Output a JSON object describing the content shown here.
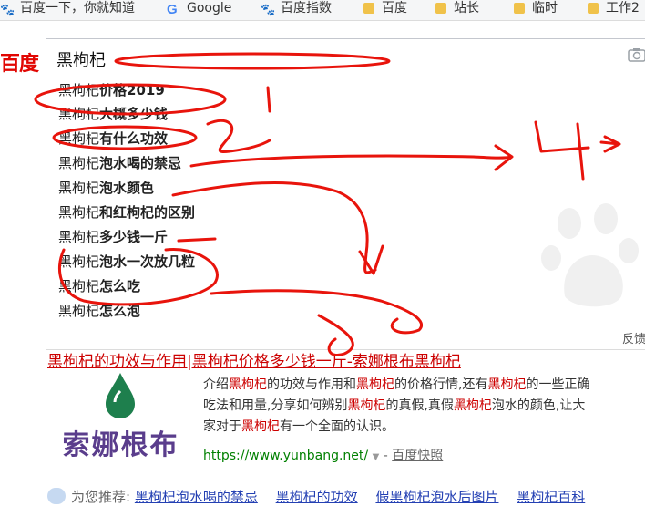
{
  "bookmarks": [
    {
      "label": "百度一下，你就知道",
      "icon": "baidu-paw-icon"
    },
    {
      "label": "Google",
      "icon": "google-icon"
    },
    {
      "label": "百度指数",
      "icon": "baidu-paw-icon"
    },
    {
      "label": "百度",
      "icon": "folder-icon"
    },
    {
      "label": "站长",
      "icon": "folder-icon"
    },
    {
      "label": "临时",
      "icon": "folder-icon"
    },
    {
      "label": "工作2",
      "icon": "folder-icon"
    }
  ],
  "logo": {
    "text": "百度"
  },
  "search": {
    "value": "黑枸杞"
  },
  "suggestions": [
    {
      "prefix": "黑枸杞",
      "suffix": "价格2019"
    },
    {
      "prefix": "黑枸杞",
      "suffix": "大概多少钱"
    },
    {
      "prefix": "黑枸杞",
      "suffix": "有什么功效"
    },
    {
      "prefix": "黑枸杞",
      "suffix": "泡水喝的禁忌"
    },
    {
      "prefix": "黑枸杞",
      "suffix": "泡水颜色"
    },
    {
      "prefix": "黑枸杞",
      "suffix": "和红枸杞的区别"
    },
    {
      "prefix": "黑枸杞",
      "suffix": "多少钱一斤"
    },
    {
      "prefix": "黑枸杞",
      "suffix": "泡水一次放几粒"
    },
    {
      "prefix": "黑枸杞",
      "suffix": "怎么吃"
    },
    {
      "prefix": "黑枸杞",
      "suffix": "怎么泡"
    }
  ],
  "suggest_feedback": "反馈",
  "result": {
    "title": "黑枸杞的功效与作用|黑枸杞价格多少钱一斤-索娜根布黑枸杞",
    "thumb_brand": "索娜根布",
    "abstract_lines": [
      [
        {
          "t": "介绍"
        },
        {
          "t": "黑枸杞",
          "hl": true
        },
        {
          "t": "的功效与作用和"
        },
        {
          "t": "黑枸杞",
          "hl": true
        },
        {
          "t": "的价格行情,还有"
        },
        {
          "t": "黑枸杞",
          "hl": true
        },
        {
          "t": "的一些正确"
        }
      ],
      [
        {
          "t": "吃法和用量,分享如何辨别"
        },
        {
          "t": "黑枸杞",
          "hl": true
        },
        {
          "t": "的真假,真假"
        },
        {
          "t": "黑枸杞",
          "hl": true
        },
        {
          "t": "泡水的颜色,让大"
        }
      ],
      [
        {
          "t": "家对于"
        },
        {
          "t": "黑枸杞",
          "hl": true
        },
        {
          "t": "有一个全面的认识。"
        }
      ]
    ],
    "url": "https://www.yunbang.net/",
    "url_suffix": " - ",
    "snapshot": "百度快照"
  },
  "recommend": {
    "label": "为您推荐:",
    "links": [
      "黑枸杞泡水喝的禁忌",
      "黑枸杞的功效",
      "假黑枸杞泡水后图片",
      "黑枸杞百科"
    ]
  },
  "colors": {
    "ink": "#e8140c",
    "logo": "#e10602",
    "highlight": "#cc0000",
    "link": "#2440b3",
    "url": "#008000"
  }
}
